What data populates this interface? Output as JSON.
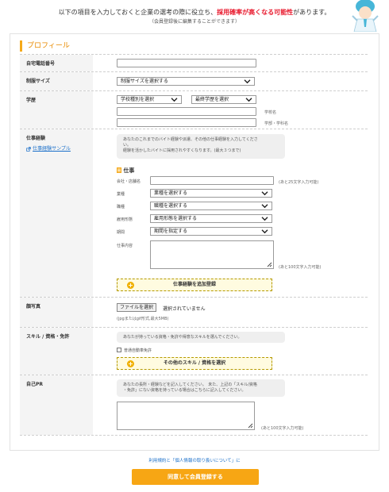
{
  "intro": {
    "line_before": "以下の項目を入力しておくと企業の選考の際に役立ち、",
    "line_red": "採用確率が高くなる可能性",
    "line_after": "があります。",
    "sub": "（会員登録後に編集することができます）"
  },
  "section_title": "プロフィール",
  "rows": {
    "home_phone": {
      "label": "自宅電話番号"
    },
    "uniform": {
      "label": "制服サイズ",
      "select": "制服サイズを選択する"
    },
    "education": {
      "label": "学歴",
      "school_type": "学校種別を選択",
      "final": "最終学歴を選択",
      "school_name_hint": "学校名",
      "faculty_hint": "学部・学科名"
    },
    "work": {
      "label": "仕事経験",
      "sample_link": "仕事経験サンプル",
      "note_l1": "あなたのこれまでのバイト経験や派遣、その他の仕事経験を入力してくださ",
      "note_l2": "い。",
      "note_l3": "経験を活かしたバイトに採用されやすくなります。(最大３つまで)",
      "job_heading": "仕事",
      "company_label": "会社・店舗名",
      "company_hint": "(あと25文字入力可能)",
      "industry_label": "業種",
      "industry_select": "業種を選択する",
      "occupation_label": "職種",
      "occupation_select": "職種を選択する",
      "employment_label": "雇用形態",
      "employment_select": "雇用形態を選択する",
      "period_label": "期間",
      "period_select": "期間を指定する",
      "content_label": "仕事内容",
      "content_hint": "(あと100文字入力可能)",
      "add_button": "仕事経験を追加登録"
    },
    "photo": {
      "label": "顔写真",
      "file_button": "ファイルを選択",
      "file_status": "選択されていません",
      "file_hint": "(jpgまたはgif形式,最大5MB)"
    },
    "skills": {
      "label": "スキル / 資格・免許",
      "note": "あなたが持っている資格・免許や得意なスキルを選んでください。",
      "checkbox_label": "普通自動車免許",
      "other_button": "その他のスキル / 資格を選択"
    },
    "pr": {
      "label": "自己PR",
      "note_l1": "あなたの長所・経験などを記入してください。　未た、上記の「スキル/資格",
      "note_l2": "・免許」にない資格を持っている場合はこちらに記入してください。",
      "hint": "(あと100文字入力可能)"
    }
  },
  "footer": {
    "terms": "利用規約と「個人情報の取り扱いについて」に",
    "submit": "同意して会員登録する"
  },
  "colors": {
    "accent": "#f7a614",
    "red": "#e8172b",
    "link": "#1a6fc9"
  }
}
